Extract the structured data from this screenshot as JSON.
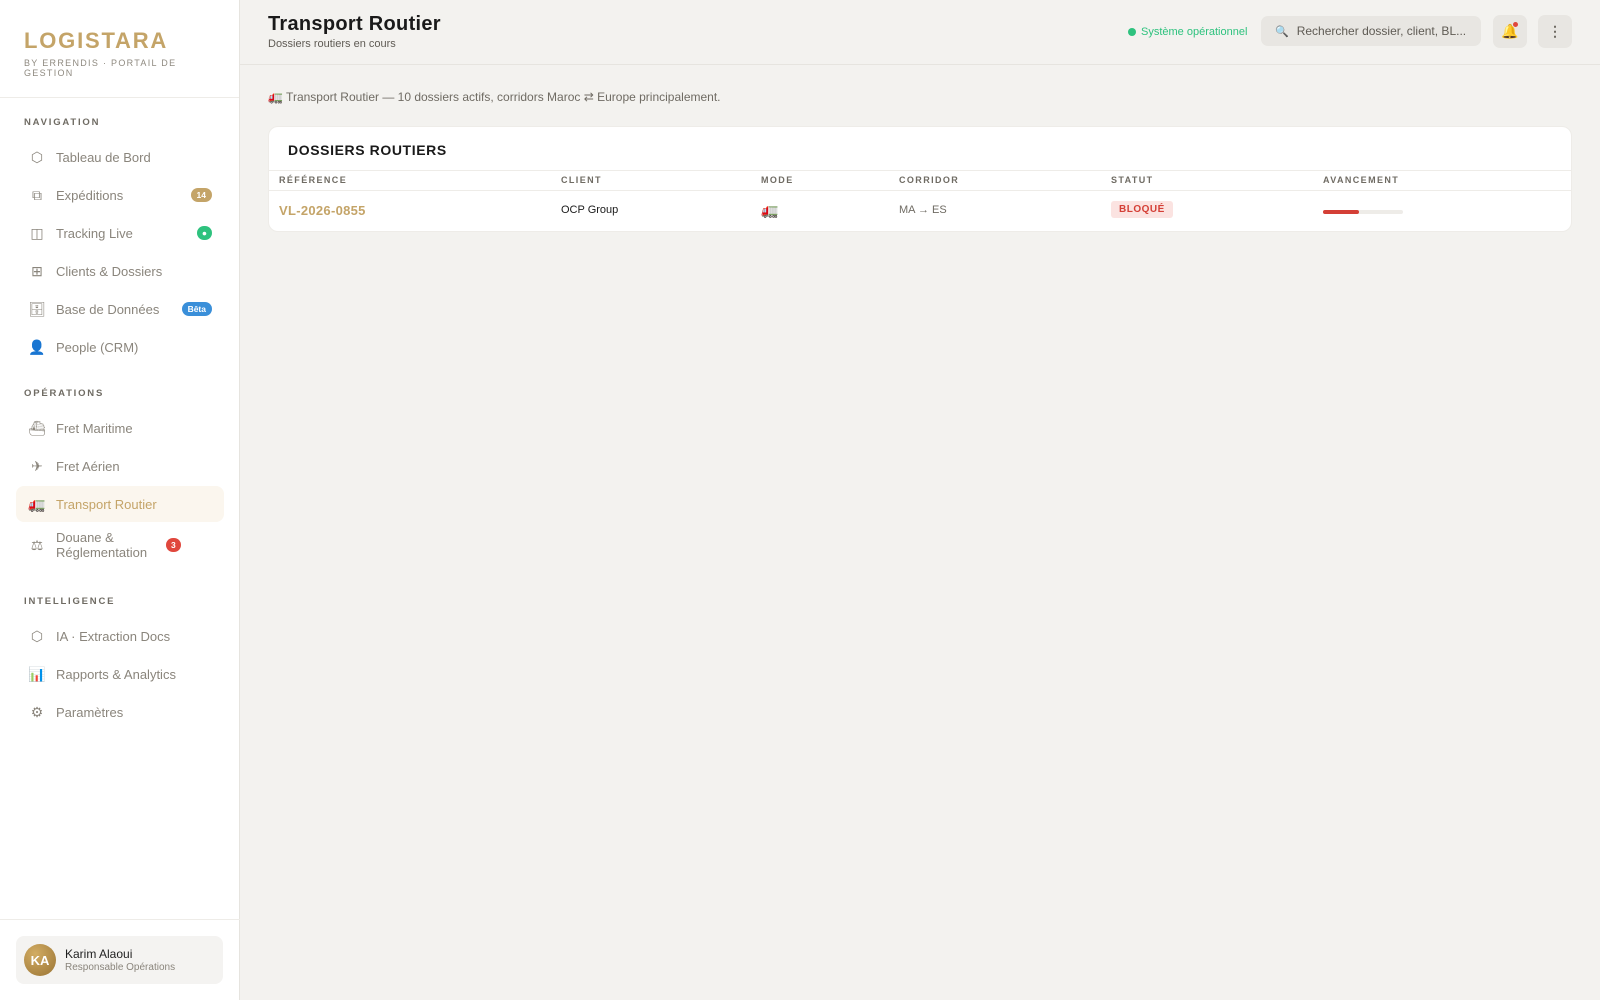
{
  "brand": {
    "title": "LOGISTARA",
    "subtitle": "BY ERRENDIS · PORTAIL DE GESTION"
  },
  "sidebar": {
    "sections": [
      {
        "title": "NAVIGATION",
        "items": [
          {
            "label": "Tableau de Bord",
            "icon": "hexagon-icon",
            "glyph": "⬡"
          },
          {
            "label": "Expéditions",
            "icon": "copy-icon",
            "glyph": "⧉",
            "badge": "14"
          },
          {
            "label": "Tracking Live",
            "icon": "map-icon",
            "glyph": "◫",
            "badge": "●"
          },
          {
            "label": "Clients & Dossiers",
            "icon": "grid-icon",
            "glyph": "⊞"
          },
          {
            "label": "Base de Données",
            "icon": "database-icon",
            "glyph": "🗄",
            "badge": "Bêta"
          },
          {
            "label": "People (CRM)",
            "icon": "person-icon",
            "glyph": "👤"
          }
        ]
      },
      {
        "title": "OPÉRATIONS",
        "items": [
          {
            "label": "Fret Maritime",
            "icon": "ship-icon",
            "glyph": "⛴"
          },
          {
            "label": "Fret Aérien",
            "icon": "plane-icon",
            "glyph": "✈"
          },
          {
            "label": "Transport Routier",
            "icon": "truck-icon",
            "glyph": "🚛",
            "active": true
          },
          {
            "label": "Douane & Réglementation",
            "icon": "scale-icon",
            "glyph": "⚖",
            "badge": "3"
          }
        ]
      },
      {
        "title": "INTELLIGENCE",
        "items": [
          {
            "label": "IA · Extraction Docs",
            "icon": "hexagon-icon",
            "glyph": "⬡"
          },
          {
            "label": "Rapports & Analytics",
            "icon": "chart-icon",
            "glyph": "📊"
          },
          {
            "label": "Paramètres",
            "icon": "gear-icon",
            "glyph": "⚙"
          }
        ]
      }
    ]
  },
  "user": {
    "initials": "KA",
    "name": "Karim Alaoui",
    "role": "Responsable Opérations"
  },
  "header": {
    "title": "Transport Routier",
    "subtitle": "Dossiers routiers en cours",
    "status": "Système opérationnel",
    "search_placeholder": "Rechercher dossier, client, BL...",
    "bell_glyph": "🔔",
    "more_glyph": "⋮"
  },
  "info_line": "🚛 Transport Routier — 10 dossiers actifs, corridors Maroc ⇄ Europe principalement.",
  "table": {
    "title": "DOSSIERS ROUTIERS",
    "columns": [
      "RÉFÉRENCE",
      "CLIENT",
      "MODE",
      "CORRIDOR",
      "STATUT",
      "AVANCEMENT"
    ],
    "rows": [
      {
        "reference": "VL-2026-0855",
        "client": "OCP Group",
        "mode_glyph": "🚛",
        "corridor": "MA → ES",
        "status": "BLOQUÉ",
        "progress_pct": 45
      }
    ]
  },
  "colors": {
    "accent": "#c4a468",
    "success": "#2ec27e",
    "danger": "#d43f36",
    "info": "#3a8fd9"
  }
}
